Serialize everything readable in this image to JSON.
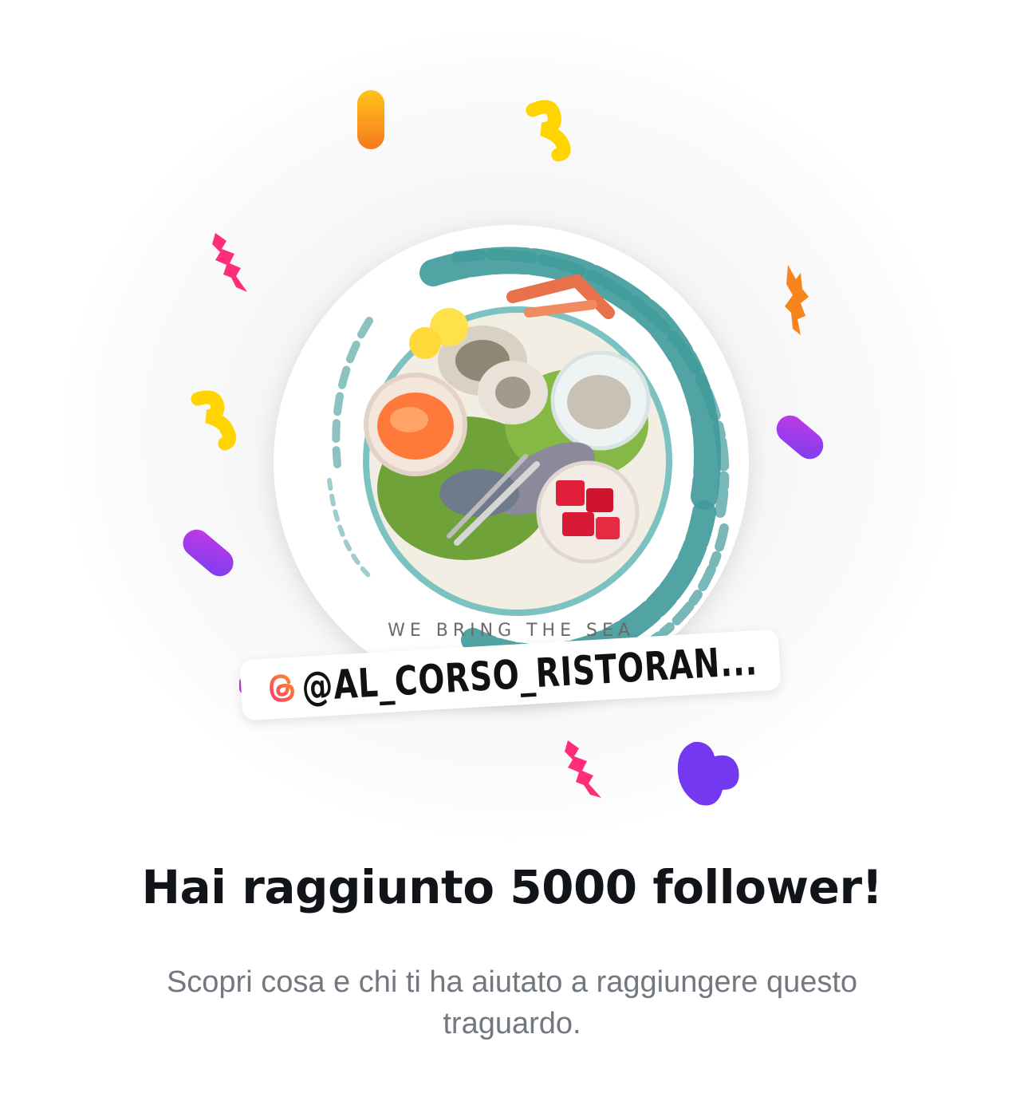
{
  "milestone": {
    "handle": "@AL_CORSO_RISTORAN...",
    "title": "Hai raggiunto 5000 follower!",
    "subtitle": "Scopri cosa e chi ti ha aiutato a raggiungere questo traguardo.",
    "avatar_tagline": "WE BRING THE SEA"
  },
  "colors": {
    "title": "#111418",
    "subtitle": "#737880",
    "brush_teal": "#3f9a9a",
    "confetti_orange": "#f7941d",
    "confetti_yellow": "#ffd400",
    "confetti_pink": "#ff2d7a",
    "confetti_purple": "#9b3cf0",
    "heart_violet": "#7438f0"
  },
  "icons": {
    "handle_icon": "threads-logo-icon",
    "heart": "heart-icon"
  }
}
